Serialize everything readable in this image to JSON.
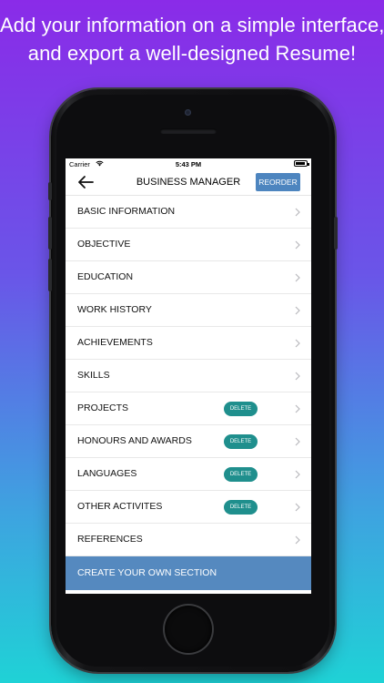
{
  "headline": {
    "line1": "Add your information on a simple interface,",
    "line2": "and export a well-designed Resume!"
  },
  "status_bar": {
    "carrier": "Carrier",
    "time": "5:43 PM"
  },
  "navbar": {
    "title": "BUSINESS MANAGER",
    "reorder_label": "REORDER"
  },
  "sections": [
    {
      "label": "BASIC INFORMATION",
      "delete": ""
    },
    {
      "label": "OBJECTIVE",
      "delete": ""
    },
    {
      "label": "EDUCATION",
      "delete": ""
    },
    {
      "label": "WORK HISTORY",
      "delete": ""
    },
    {
      "label": "ACHIEVEMENTS",
      "delete": ""
    },
    {
      "label": "SKILLS",
      "delete": ""
    },
    {
      "label": "PROJECTS",
      "delete": "DELETE"
    },
    {
      "label": "HONOURS AND AWARDS",
      "delete": "DELETE"
    },
    {
      "label": "LANGUAGES",
      "delete": "DELETE"
    },
    {
      "label": "OTHER ACTIVITES",
      "delete": "DELETE"
    },
    {
      "label": "REFERENCES",
      "delete": ""
    }
  ],
  "create_section_label": "CREATE YOUR OWN SECTION",
  "colors": {
    "accent": "#4d85bf",
    "delete": "#1f8f8d",
    "gradient_top": "#8a2be8",
    "gradient_bottom": "#1fd2d6"
  }
}
